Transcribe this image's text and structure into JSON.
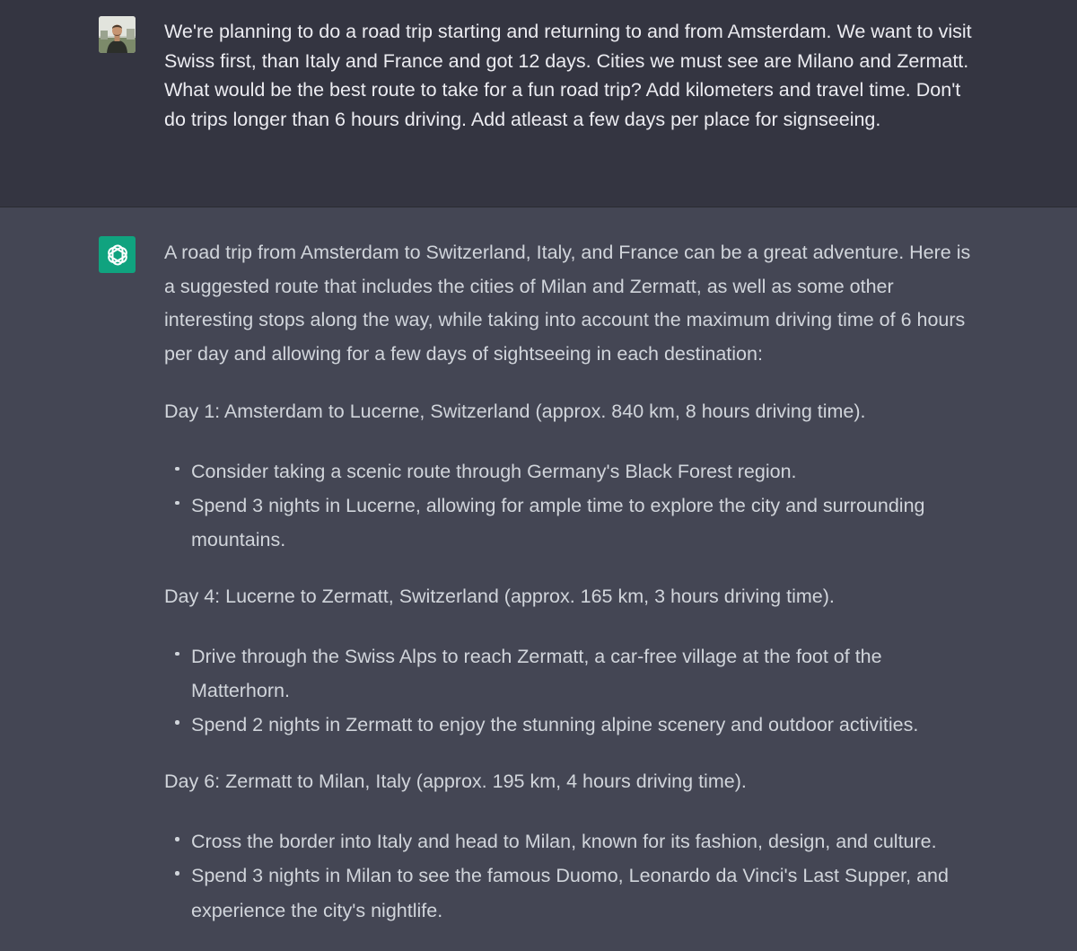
{
  "colors": {
    "user_background": "#343541",
    "assistant_background": "#444654",
    "assistant_avatar": "#10a37f",
    "user_text": "#ececf1",
    "assistant_text": "#d1d5db"
  },
  "user_message": {
    "avatar": "user-photo-avatar",
    "text": "We're planning to do a road trip starting and returning to and from Amsterdam. We want to visit Swiss first, than Italy and France and got 12 days. Cities we must see are Milano and Zermatt. What would be the best route to take for a fun road trip? Add kilometers and travel time. Don't do trips longer than 6 hours driving. Add atleast a few days per place for signseeing."
  },
  "assistant_message": {
    "avatar": "openai-logo-icon",
    "intro": "A road trip from Amsterdam to Switzerland, Italy, and France can be a great adventure. Here is a suggested route that includes the cities of Milan and Zermatt, as well as some other interesting stops along the way, while taking into account the maximum driving time of 6 hours per day and allowing for a few days of sightseeing in each destination:",
    "days": [
      {
        "heading": "Day 1: Amsterdam to Lucerne, Switzerland (approx. 840 km, 8 hours driving time).",
        "bullets": [
          "Consider taking a scenic route through Germany's Black Forest region.",
          "Spend 3 nights in Lucerne, allowing for ample time to explore the city and surrounding mountains."
        ]
      },
      {
        "heading": "Day 4: Lucerne to Zermatt, Switzerland (approx. 165 km, 3 hours driving time).",
        "bullets": [
          "Drive through the Swiss Alps to reach Zermatt, a car-free village at the foot of the Matterhorn.",
          "Spend 2 nights in Zermatt to enjoy the stunning alpine scenery and outdoor activities."
        ]
      },
      {
        "heading": "Day 6: Zermatt to Milan, Italy (approx. 195 km, 4 hours driving time).",
        "bullets": [
          "Cross the border into Italy and head to Milan, known for its fashion, design, and culture.",
          "Spend 3 nights in Milan to see the famous Duomo, Leonardo da Vinci's Last Supper, and experience the city's nightlife."
        ]
      }
    ]
  }
}
